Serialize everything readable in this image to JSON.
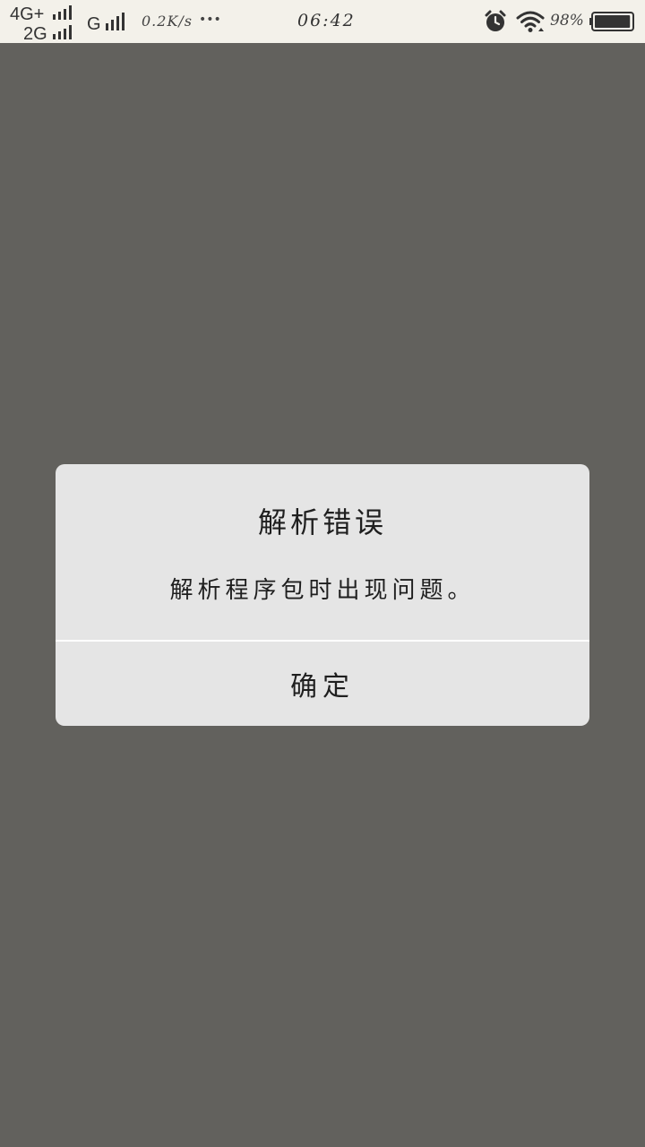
{
  "status_bar": {
    "sim1_label": "4G+",
    "sim2_label": "2G",
    "network_type": "G",
    "net_speed": "0.2K/s",
    "more_indicator": "•••",
    "time": "06:42",
    "alarm_icon": "alarm-clock-icon",
    "wifi_icon": "wifi-icon",
    "battery_percent": "98%",
    "battery_level": 0.98
  },
  "dialog": {
    "title": "解析错误",
    "message": "解析程序包时出现问题。",
    "confirm_label": "确定"
  },
  "colors": {
    "overlay": "#62615d",
    "status_bar_bg": "#f3f1ea",
    "dialog_bg": "#e5e5e5",
    "text": "#1f1f1f"
  }
}
